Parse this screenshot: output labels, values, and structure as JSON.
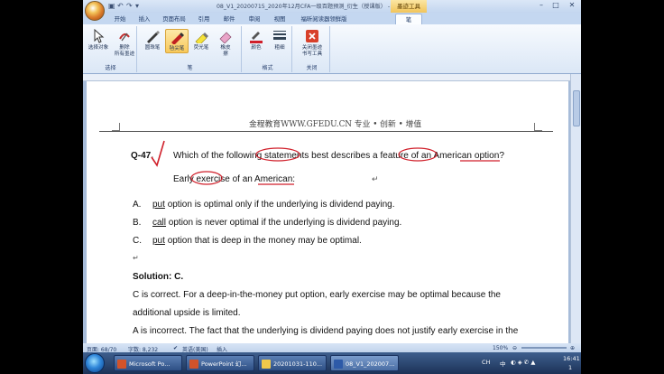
{
  "window": {
    "title": "08_V1_20200715_2020年12月CFA一级百题预测_衍生（授课版） - Mic...",
    "context_tab_group": "墨迹工具"
  },
  "tabs": [
    {
      "label": "开始"
    },
    {
      "label": "插入"
    },
    {
      "label": "页面布局"
    },
    {
      "label": "引用"
    },
    {
      "label": "邮件"
    },
    {
      "label": "审阅"
    },
    {
      "label": "视图"
    },
    {
      "label": "福昕阅读器领鲜版"
    },
    {
      "label": "笔"
    }
  ],
  "ribbon": {
    "groups": [
      {
        "label": "选择",
        "buttons": [
          {
            "label": "选择对象"
          },
          {
            "label": "删除\n所有墨迹"
          }
        ]
      },
      {
        "label": "笔",
        "buttons": [
          {
            "label": "圆珠笔"
          },
          {
            "label": "毡尖笔"
          },
          {
            "label": "荧光笔"
          },
          {
            "label": "橡皮\n擦"
          }
        ]
      },
      {
        "label": "格式",
        "buttons": [
          {
            "label": "颜色"
          },
          {
            "label": "粗细"
          }
        ]
      },
      {
        "label": "关闭",
        "buttons": [
          {
            "label": "关闭墨迹\n书写工具"
          }
        ]
      }
    ]
  },
  "document": {
    "header": "金程教育WWW.GFEDU.CN 专业 • 创新 • 增值",
    "question_number": "Q-47.",
    "question_line1": "Which of the following statements best describes a feature of an American option?",
    "question_line2": "Early exercise of an American:",
    "options": [
      {
        "letter": "A.",
        "keyword": "put",
        "text": "option is optimal only if the underlying is dividend paying."
      },
      {
        "letter": "B.",
        "keyword": "call",
        "text": "option is never optimal if the underlying is dividend paying."
      },
      {
        "letter": "C.",
        "keyword": "put",
        "text": "option that is deep in the money may be optimal."
      }
    ],
    "solution_label": "Solution: C.",
    "solution_line1": "C is correct. For a deep-in-the-money put option, early exercise may be optimal because the",
    "solution_line2": "additional upside is limited.",
    "solution_line3": "A is incorrect. The fact that the underlying is dividend paying does not justify early exercise in the",
    "paragraph_mark": "↵"
  },
  "statusbar": {
    "page": "页面: 68/70",
    "words": "字数: 8,232",
    "language": "英语(美国)",
    "mode": "插入",
    "zoom": "150%"
  },
  "taskbar": {
    "tasks": [
      {
        "label": "Microsoft Po..."
      },
      {
        "label": "PowerPoint 幻..."
      },
      {
        "label": "20201031-110..."
      },
      {
        "label": "08_V1_202007..."
      }
    ],
    "tray_lang": "CH",
    "tray_input": "中",
    "time": "16:41",
    "day": "1"
  },
  "colors": {
    "ink_red": "#d01f2a",
    "accent_orange": "#f8c95a"
  }
}
